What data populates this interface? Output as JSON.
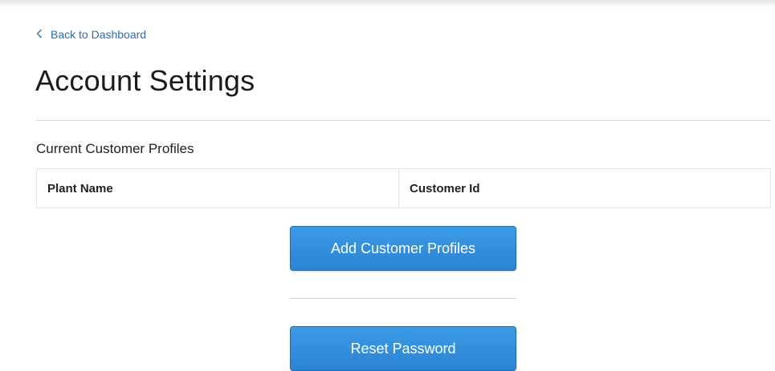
{
  "nav": {
    "back_icon": "chevron-left-icon",
    "back_label": "Back to Dashboard"
  },
  "page": {
    "title": "Account Settings"
  },
  "profiles": {
    "heading": "Current Customer Profiles",
    "columns": [
      "Plant Name",
      "Customer Id"
    ],
    "rows": []
  },
  "actions": {
    "add_label": "Add Customer Profiles",
    "reset_label": "Reset Password"
  },
  "colors": {
    "link": "#2b6cb0",
    "button": "#2a84d3",
    "button_text": "#ffffff"
  }
}
